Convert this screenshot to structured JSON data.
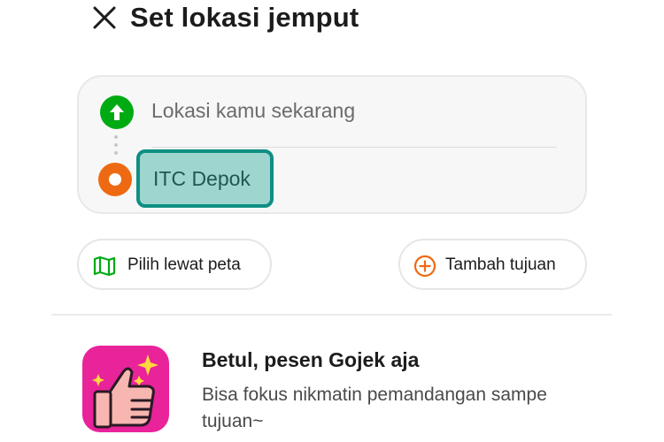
{
  "header": {
    "title": "Set lokasi jemput",
    "close_icon": "close-icon"
  },
  "location_card": {
    "pickup": {
      "placeholder": "Lokasi kamu sekarang",
      "icon": "arrow-up-icon",
      "icon_color": "#00aa13"
    },
    "destination": {
      "value": "ITC Depok",
      "icon": "destination-dot-icon",
      "icon_color": "#ee6a12",
      "highlight_color": "#9ed6cf",
      "highlight_border": "#0e8f83"
    }
  },
  "actions": {
    "choose_on_map": {
      "label": "Pilih lewat peta",
      "icon": "map-icon",
      "icon_color": "#00aa13"
    },
    "add_destination": {
      "label": "Tambah tujuan",
      "icon": "plus-circle-icon",
      "icon_color": "#ee6a12"
    }
  },
  "promo": {
    "title": "Betul, pesen Gojek aja",
    "subtitle": "Bisa fokus nikmatin pemandangan sampe tujuan~",
    "image_icon": "thumbs-up-sparkle-icon",
    "image_bg": "#e9239a"
  }
}
